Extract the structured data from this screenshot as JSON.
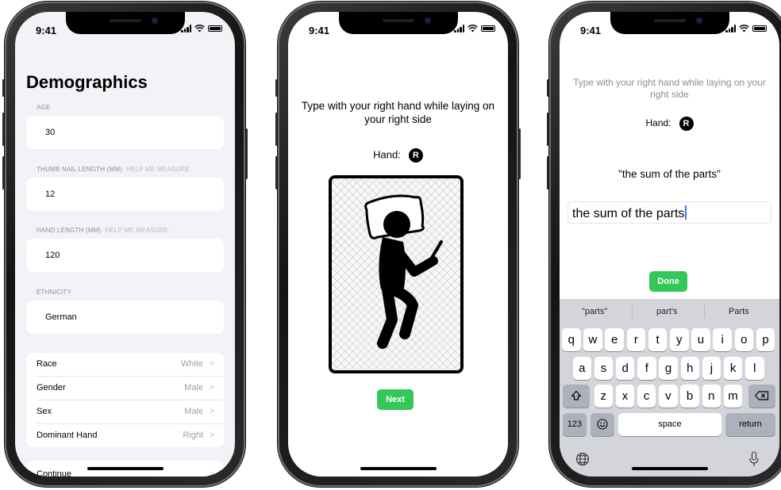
{
  "status_time": "9:41",
  "phone1": {
    "title": "Demographics",
    "age_label": "AGE",
    "age_value": "30",
    "thumb_label": "THUMB NAIL LENGTH (MM)",
    "thumb_help": "HELP ME MEASURE",
    "thumb_value": "12",
    "hand_label": "HAND LENGTH (MM)",
    "hand_help": "HELP ME MEASURE",
    "hand_value": "120",
    "ethnicity_label": "ETHNICITY",
    "ethnicity_value": "German",
    "rows": [
      {
        "key": "Race",
        "value": "White"
      },
      {
        "key": "Gender",
        "value": "Male"
      },
      {
        "key": "Sex",
        "value": "Male"
      },
      {
        "key": "Dominant Hand",
        "value": "Right"
      }
    ],
    "continue_label": "Continue",
    "chevron": ">"
  },
  "phone2": {
    "instruction": "Type with your right hand while laying on your right side",
    "hand_label": "Hand:",
    "hand_badge": "R",
    "next_label": "Next"
  },
  "phone3": {
    "instruction": "Type with your right hand while laying on your right side",
    "hand_label": "Hand:",
    "hand_badge": "R",
    "prompt": "\"the sum of the parts\"",
    "typed_text": "the sum of the parts",
    "done_label": "Done",
    "suggestions": [
      "\"parts\"",
      "part's",
      "Parts"
    ],
    "keys_row1": [
      "q",
      "w",
      "e",
      "r",
      "t",
      "y",
      "u",
      "i",
      "o",
      "p"
    ],
    "keys_row2": [
      "a",
      "s",
      "d",
      "f",
      "g",
      "h",
      "j",
      "k",
      "l"
    ],
    "keys_row3": [
      "z",
      "x",
      "c",
      "v",
      "b",
      "n",
      "m"
    ],
    "key_123": "123",
    "key_space": "space",
    "key_return": "return"
  },
  "colors": {
    "accent_green": "#34c759",
    "caret_blue": "#3478f6",
    "grouped_bg": "#f2f2f7"
  }
}
